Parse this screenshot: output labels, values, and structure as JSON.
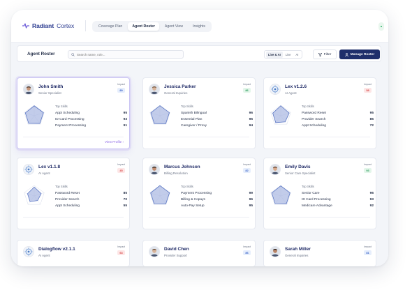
{
  "app": {
    "brand_strong": "Radiant",
    "brand_rest": "Cortex",
    "tabs": [
      "Coverage Plan",
      "Agent Roster",
      "Agent View",
      "Insights"
    ],
    "active_tab": "Agent Roster"
  },
  "toolbar": {
    "title": "Agent Roster",
    "search_placeholder": "Search name, role...",
    "segments": [
      "Live & AI",
      "Live",
      "AI"
    ],
    "active_segment": "Live & AI",
    "filter_label": "Filter",
    "manage_label": "Manage Roster"
  },
  "labels": {
    "impact": "Impact",
    "top_skills": "Top Skills",
    "view_profile": "View Profile"
  },
  "agents": [
    {
      "name": "John Smith",
      "role": "Senior Specialist",
      "impact": "89",
      "impact_color": "blue",
      "avatar": "human",
      "skills": [
        [
          "Appt Scheduling",
          "95"
        ],
        [
          "ID Card Processing",
          "93"
        ],
        [
          "Payment Processing",
          "91"
        ]
      ],
      "selected": true
    },
    {
      "name": "Jessica Parker",
      "role": "General Inquiries",
      "impact": "86",
      "impact_color": "green",
      "avatar": "human",
      "skills": [
        [
          "Spanish Bilingual",
          "96"
        ],
        [
          "Essential Plan",
          "95"
        ],
        [
          "Caregiver / Proxy",
          "94"
        ]
      ]
    },
    {
      "name": "Lex v1.2.6",
      "role": "AI Agent",
      "impact": "58",
      "impact_color": "red",
      "avatar": "bot",
      "skills": [
        [
          "Password Reset",
          "95"
        ],
        [
          "Provider Search",
          "85"
        ],
        [
          "Appt Scheduling",
          "72"
        ]
      ]
    },
    {
      "name": "Lex v1.1.8",
      "role": "AI Agent",
      "impact": "45",
      "impact_color": "red",
      "avatar": "bot",
      "skills": [
        [
          "Password Reset",
          "85"
        ],
        [
          "Provider Search",
          "70"
        ],
        [
          "Appt Scheduling",
          "55"
        ]
      ]
    },
    {
      "name": "Marcus Johnson",
      "role": "Billing Resolution",
      "impact": "82",
      "impact_color": "blue",
      "avatar": "human",
      "skills": [
        [
          "Payment Processing",
          "99"
        ],
        [
          "Billing & Copays",
          "96"
        ],
        [
          "Auto-Pay Setup",
          "95"
        ]
      ]
    },
    {
      "name": "Emily Davis",
      "role": "Senior Care Specialist",
      "impact": "93",
      "impact_color": "green",
      "avatar": "human",
      "skills": [
        [
          "Senior Care",
          "96"
        ],
        [
          "ID Card Processing",
          "93"
        ],
        [
          "Medicare Advantage",
          "92"
        ]
      ]
    },
    {
      "name": "Dialogflow v2.1.1",
      "role": "AI Agent",
      "impact": "63",
      "impact_color": "red",
      "avatar": "bot"
    },
    {
      "name": "David Chen",
      "role": "Provider Support",
      "impact": "86",
      "impact_color": "blue",
      "avatar": "human"
    },
    {
      "name": "Sarah Miller",
      "role": "General Inquiries",
      "impact": "81",
      "impact_color": "blue",
      "avatar": "human"
    }
  ],
  "colors": {
    "brand": "#2a3a8f",
    "primary_button": "#1f2f6b",
    "radar_fill": "#8fa3d8",
    "selected_border": "#c9c3f3",
    "view_profile": "#8a63e6"
  }
}
